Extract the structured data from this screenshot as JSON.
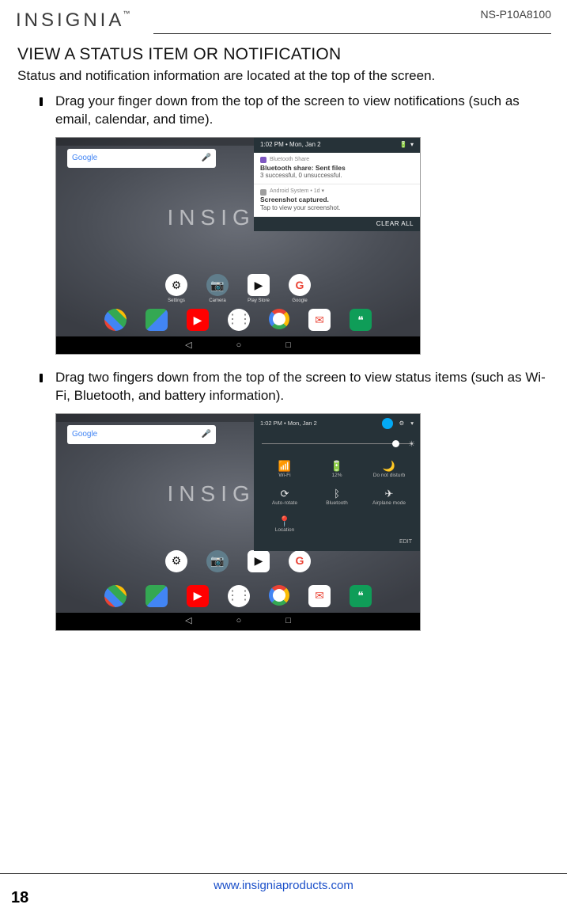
{
  "header": {
    "brand": "INSIGNIA",
    "model": "NS-P10A8100"
  },
  "section": {
    "title": "VIEW A STATUS ITEM OR NOTIFICATION",
    "intro": "Status and notification information are located at the top of the screen.",
    "bullets": [
      "Drag your finger down from the top of the screen to view notifications (such as email, calendar, and time).",
      "Drag two fingers down from the top of the screen to view status items (such as Wi-Fi, Bluetooth, and battery information)."
    ]
  },
  "fig1": {
    "wallpaper_text": "INSIGNIA",
    "search_label": "Google",
    "status_time": "1:02 PM  •  Mon, Jan 2",
    "status_tr": "▾ ▮ ⋮",
    "notif1_app": "Bluetooth Share",
    "notif1_title": "Bluetooth share: Sent files",
    "notif1_body": "3 successful, 0 unsuccessful.",
    "notif2_app": "Android System • 1d ▾",
    "notif2_title": "Screenshot captured.",
    "notif2_body": "Tap to view your screenshot.",
    "clear_all": "CLEAR ALL",
    "apps_r1": [
      "Settings",
      "Camera",
      "Play Store",
      "Google"
    ],
    "nav": {
      "back": "◁",
      "home": "○",
      "recent": "□"
    }
  },
  "fig2": {
    "wallpaper_text": "INSIGNIA",
    "search_label": "Google",
    "qs_time": "1:02 PM  •  Mon, Jan 2",
    "tiles": [
      {
        "icon": "📶",
        "label": "Wi-Fi"
      },
      {
        "icon": "🔋",
        "label": "12%"
      },
      {
        "icon": "🌙",
        "label": "Do not disturb"
      },
      {
        "icon": "⟳",
        "label": "Auto-rotate"
      },
      {
        "icon": "ᛒ",
        "label": "Bluetooth"
      },
      {
        "icon": "✈",
        "label": "Airplane mode"
      },
      {
        "icon": "📍",
        "label": "Location"
      }
    ],
    "edit": "EDIT",
    "nav": {
      "back": "◁",
      "home": "○",
      "recent": "□"
    }
  },
  "footer": {
    "url": "www.insigniaproducts.com",
    "page": "18"
  }
}
